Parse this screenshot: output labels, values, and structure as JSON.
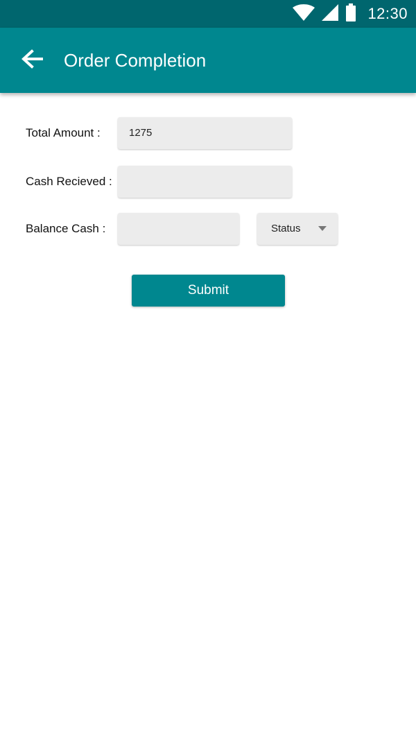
{
  "status_bar": {
    "time": "12:30",
    "icons": [
      "wifi-icon",
      "cellular-signal-icon",
      "battery-icon"
    ]
  },
  "app_bar": {
    "back_icon": "arrow-left-icon",
    "title": "Order Completion"
  },
  "form": {
    "total_amount": {
      "label": "Total Amount :",
      "value": "1275"
    },
    "cash_received": {
      "label": "Cash Recieved :",
      "value": ""
    },
    "balance_cash": {
      "label": "Balance Cash :",
      "value": ""
    },
    "status_select": {
      "selected": "Status"
    },
    "submit_label": "Submit"
  },
  "colors": {
    "status_bar": "#00666e",
    "app_bar": "#00878f",
    "accent": "#00878f",
    "field_background": "#ececec"
  }
}
